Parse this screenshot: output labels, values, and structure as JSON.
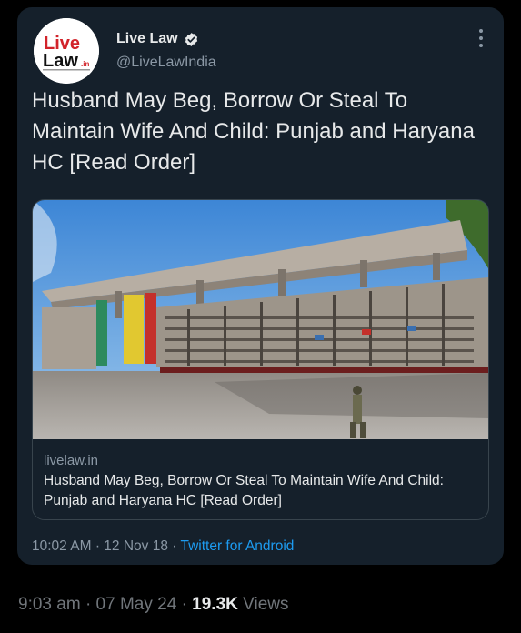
{
  "author": {
    "name": "Live Law",
    "handle": "@LiveLawIndia",
    "logo_text_line1": "Live",
    "logo_text_line2": "Law",
    "logo_suffix": ".in"
  },
  "tweet": {
    "text": "Husband May Beg, Borrow Or Steal To Maintain Wife And Child: Punjab and Haryana HC [Read Order]",
    "time": "10:02 AM",
    "date": "12 Nov 18",
    "source": "Twitter for Android"
  },
  "link_card": {
    "domain": "livelaw.in",
    "title": "Husband May Beg, Borrow Or Steal To Maintain Wife And Child: Punjab and Haryana HC [Read Order]"
  },
  "footer": {
    "time": "9:03 am",
    "date": "07 May 24",
    "views_count": "19.3K",
    "views_label": "Views"
  },
  "colors": {
    "card_bg": "#15202b",
    "accent": "#1d9bf0",
    "logo_red": "#d2232a"
  },
  "icons": [
    "verified-badge-icon",
    "more-options-icon"
  ]
}
